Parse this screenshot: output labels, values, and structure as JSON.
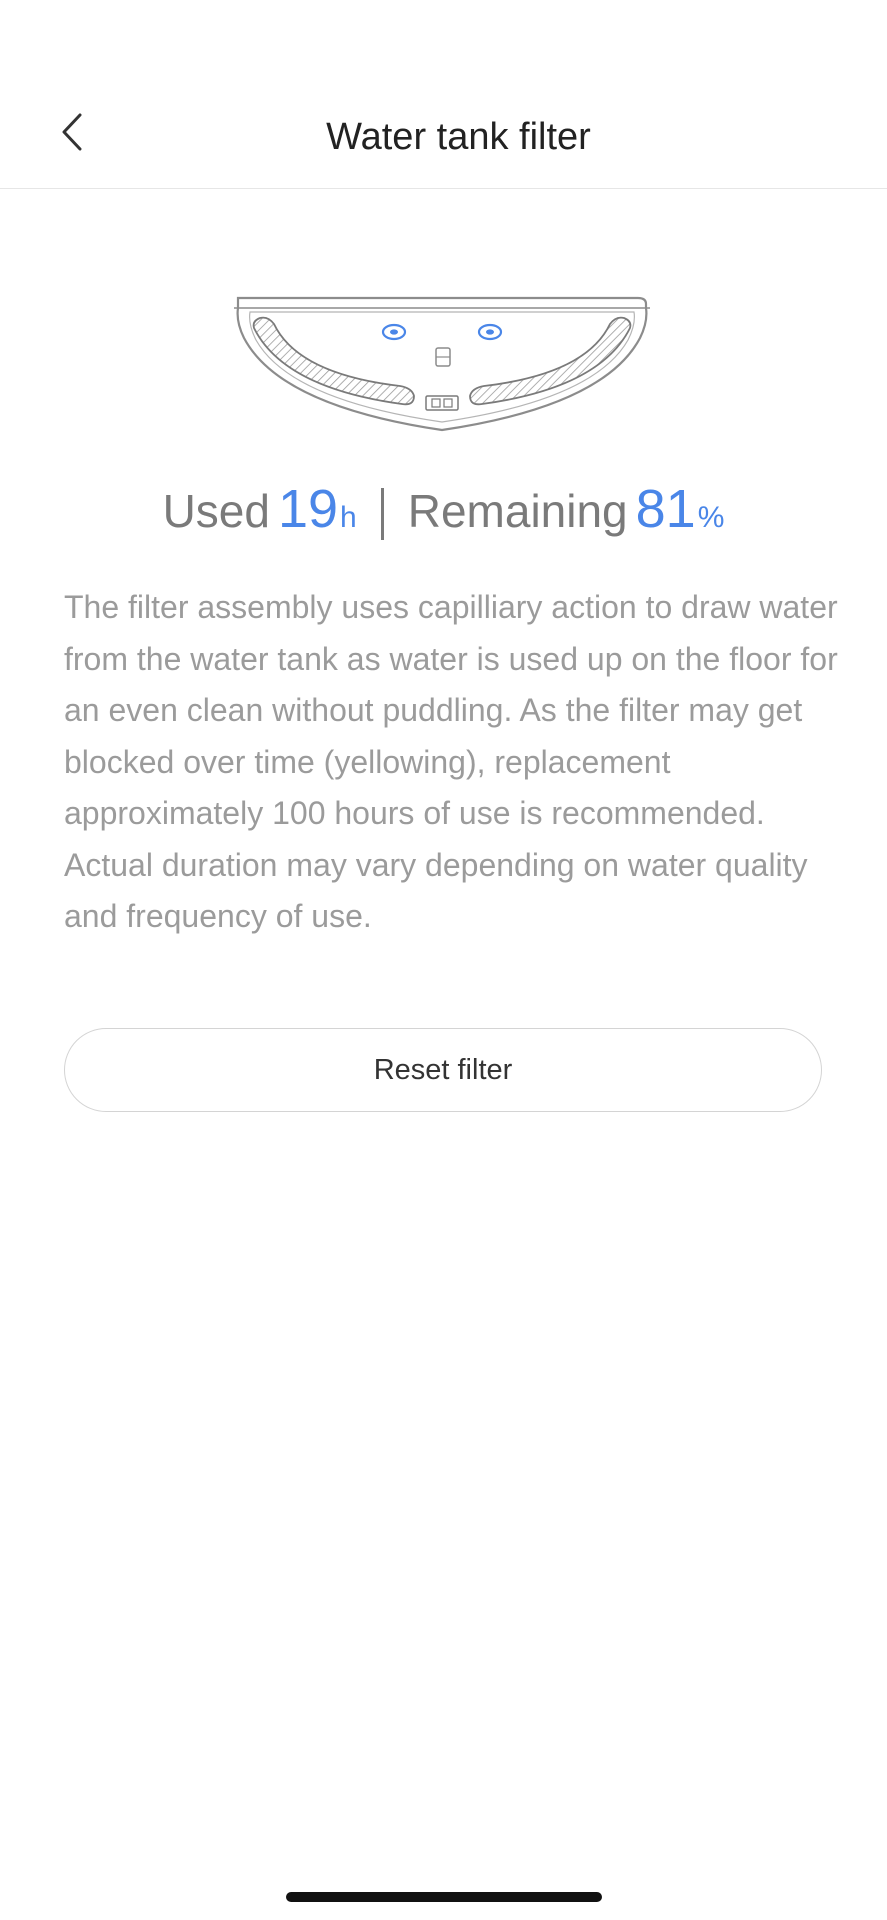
{
  "header": {
    "title": "Water tank filter",
    "back_icon": "chevron-left-icon"
  },
  "illustration": {
    "icon": "robot-vacuum-bottom-icon",
    "accent_color": "#4a86e8"
  },
  "stats": {
    "used_label": "Used",
    "used_value": "19",
    "used_unit": "h",
    "remaining_label": "Remaining",
    "remaining_value": "81",
    "remaining_unit": "%",
    "value_color": "#4a86e8"
  },
  "description": "The filter assembly uses capilliary action to draw water from the water tank as water is used up on the floor for an even clean without puddling. As the filter may get blocked over time (yellowing), replacement approximately 100 hours of use is recommended. Actual duration may vary depending on water quality and frequency of use.",
  "actions": {
    "reset_label": "Reset filter"
  }
}
